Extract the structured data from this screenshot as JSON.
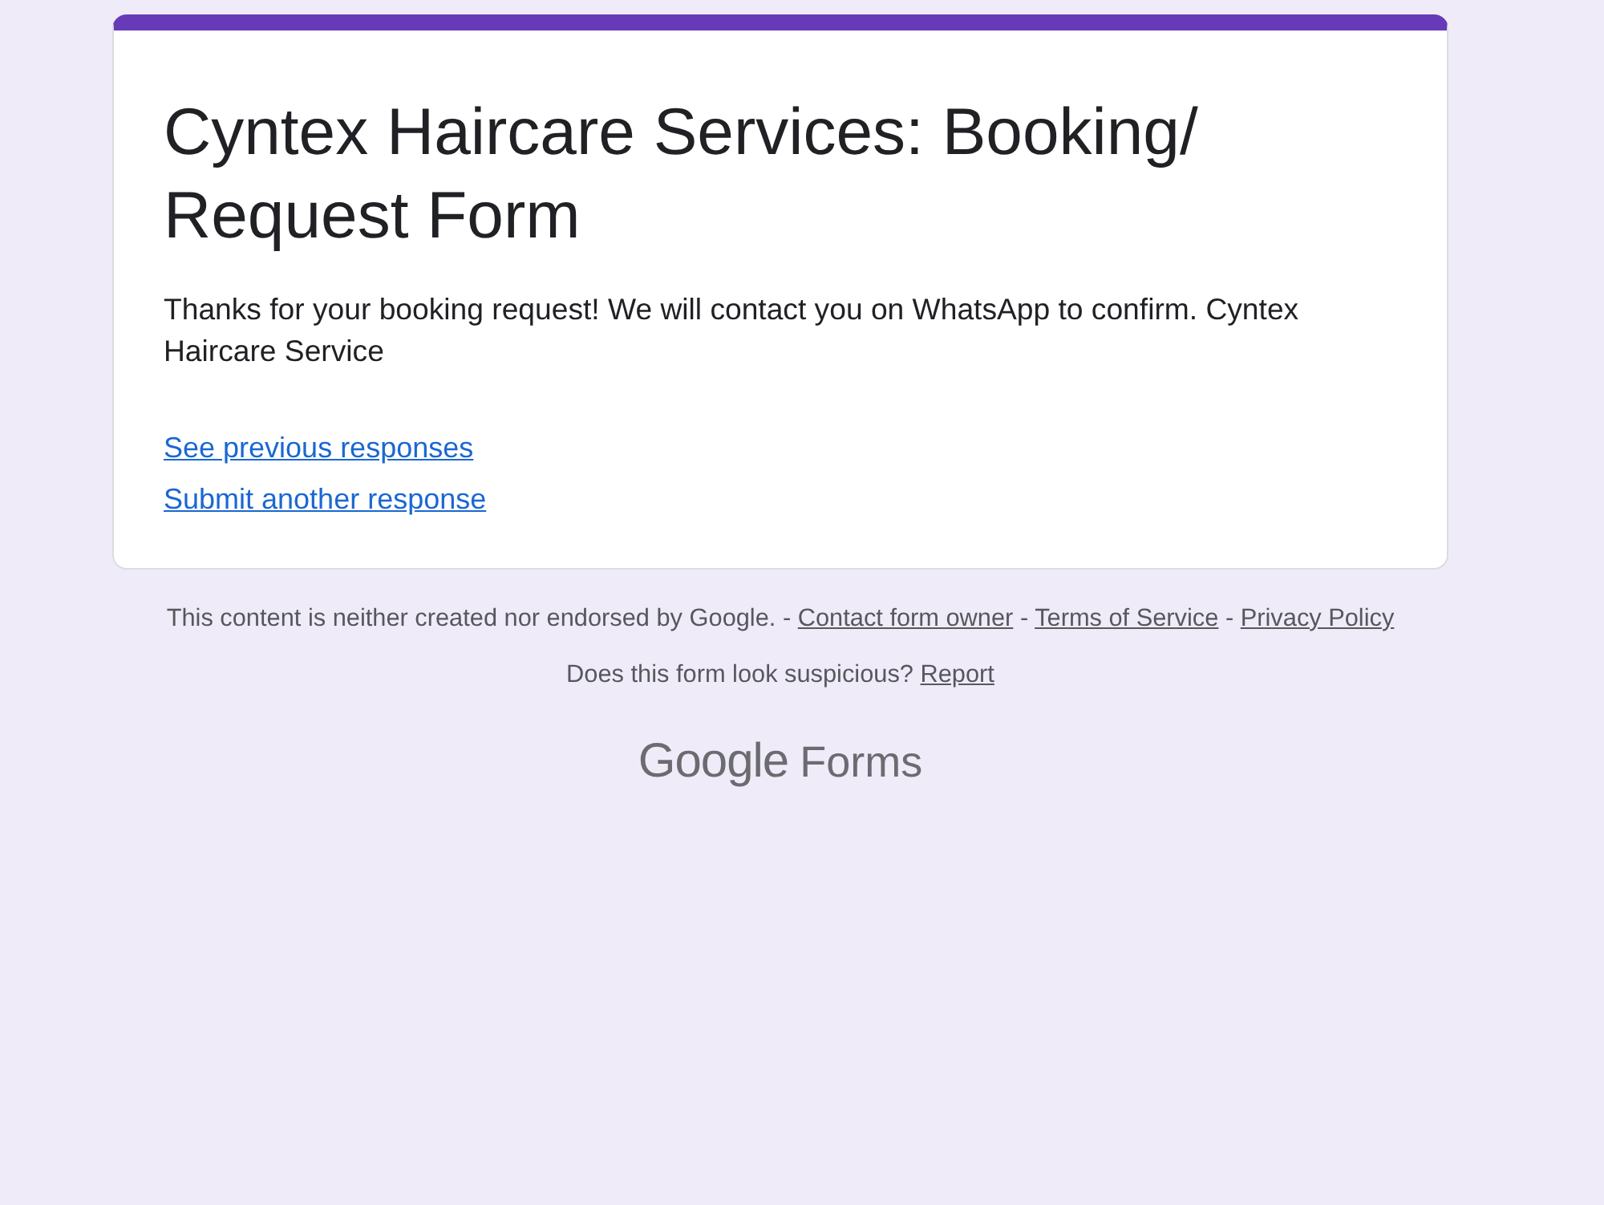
{
  "card": {
    "title": "Cyntex Haircare Services: Booking/ Request Form",
    "description": "Thanks for your booking request! We will contact you on WhatsApp to confirm. Cyntex Haircare Service",
    "links": [
      "See previous responses",
      "Submit another response"
    ]
  },
  "footer": {
    "disclaimer": "This content is neither created nor endorsed by Google.",
    "separator": "-",
    "links": [
      "Contact form owner",
      "Terms of Service",
      "Privacy Policy"
    ],
    "report_prompt": "Does this form look suspicious?",
    "report_link": "Report"
  },
  "brand": {
    "logo": "Google",
    "product": "Forms"
  }
}
